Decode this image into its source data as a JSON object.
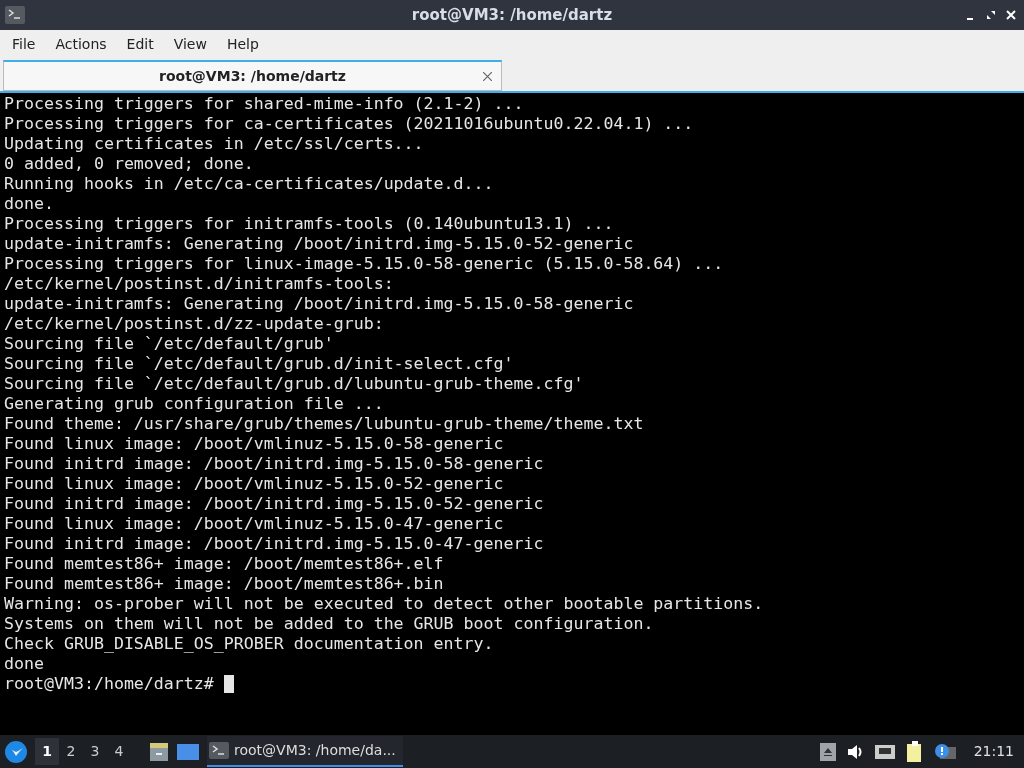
{
  "window": {
    "title": "root@VM3: /home/dartz"
  },
  "menu": [
    "File",
    "Actions",
    "Edit",
    "View",
    "Help"
  ],
  "tabs": [
    {
      "label": "root@VM3: /home/dartz",
      "selected": true
    }
  ],
  "terminal": {
    "lines": [
      "Processing triggers for shared-mime-info (2.1-2) ...",
      "Processing triggers for ca-certificates (20211016ubuntu0.22.04.1) ...",
      "Updating certificates in /etc/ssl/certs...",
      "0 added, 0 removed; done.",
      "Running hooks in /etc/ca-certificates/update.d...",
      "done.",
      "Processing triggers for initramfs-tools (0.140ubuntu13.1) ...",
      "update-initramfs: Generating /boot/initrd.img-5.15.0-52-generic",
      "Processing triggers for linux-image-5.15.0-58-generic (5.15.0-58.64) ...",
      "/etc/kernel/postinst.d/initramfs-tools:",
      "update-initramfs: Generating /boot/initrd.img-5.15.0-58-generic",
      "/etc/kernel/postinst.d/zz-update-grub:",
      "Sourcing file `/etc/default/grub'",
      "Sourcing file `/etc/default/grub.d/init-select.cfg'",
      "Sourcing file `/etc/default/grub.d/lubuntu-grub-theme.cfg'",
      "Generating grub configuration file ...",
      "Found theme: /usr/share/grub/themes/lubuntu-grub-theme/theme.txt",
      "Found linux image: /boot/vmlinuz-5.15.0-58-generic",
      "Found initrd image: /boot/initrd.img-5.15.0-58-generic",
      "Found linux image: /boot/vmlinuz-5.15.0-52-generic",
      "Found initrd image: /boot/initrd.img-5.15.0-52-generic",
      "Found linux image: /boot/vmlinuz-5.15.0-47-generic",
      "Found initrd image: /boot/initrd.img-5.15.0-47-generic",
      "Found memtest86+ image: /boot/memtest86+.elf",
      "Found memtest86+ image: /boot/memtest86+.bin",
      "Warning: os-prober will not be executed to detect other bootable partitions.",
      "Systems on them will not be added to the GRUB boot configuration.",
      "Check GRUB_DISABLE_OS_PROBER documentation entry.",
      "done"
    ],
    "prompt": "root@VM3:/home/dartz#"
  },
  "taskbar": {
    "desktops": [
      {
        "label": "1",
        "selected": true
      },
      {
        "label": "2",
        "selected": false
      },
      {
        "label": "3",
        "selected": false
      },
      {
        "label": "4",
        "selected": false
      }
    ],
    "tasks": [
      {
        "label": "root@VM3: /home/da...",
        "selected": true
      }
    ],
    "clock": "21:11"
  }
}
